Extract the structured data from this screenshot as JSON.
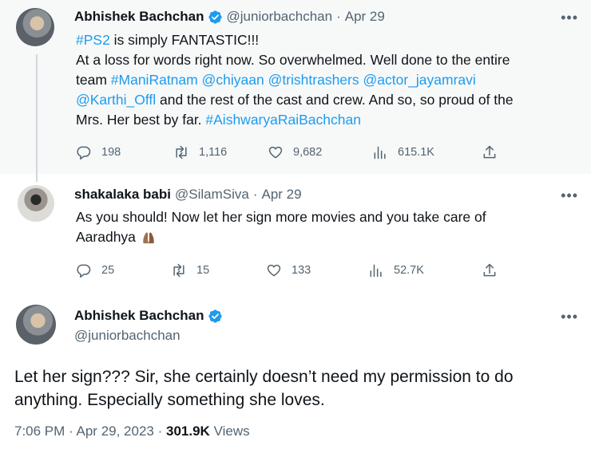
{
  "tweet1": {
    "name": "Abhishek Bachchan",
    "handle": "@juniorbachchan",
    "sep": "·",
    "date": "Apr 29",
    "more": "•••",
    "hashtag_ps2": "#PS2",
    "line1_rest": " is simply FANTASTIC!!!",
    "line2": "At a loss for words right now. So overwhelmed. Well done to the entire",
    "line3_pre": "team ",
    "m1": "#ManiRatnam",
    "m2": "@chiyaan",
    "m3": "@trishtrashers",
    "m4": "@actor_jayamravi",
    "m5": "@Karthi_Offl",
    "line4_rest": " and the rest of the cast and crew. And so, so proud of the",
    "line5_pre": "Mrs. Her best by far. ",
    "m6": "#AishwaryaRaiBachchan",
    "stats": {
      "replies": "198",
      "retweets": "1,116",
      "likes": "9,682",
      "views": "615.1K"
    }
  },
  "tweet2": {
    "name": "shakalaka babi",
    "handle": "@SilamSiva",
    "sep": "·",
    "date": "Apr 29",
    "more": "•••",
    "line1": "As you should! Now let her sign more movies and you take care of",
    "line2": "Aaradhya",
    "stats": {
      "replies": "25",
      "retweets": "15",
      "likes": "133",
      "views": "52.7K"
    }
  },
  "tweet3": {
    "name": "Abhishek Bachchan",
    "handle": "@juniorbachchan",
    "more": "•••",
    "text": "Let her sign??? Sir, she certainly doesn’t need my permission to do anything. Especially something she loves.",
    "time": "7:06 PM",
    "sep1": "·",
    "date": "Apr 29, 2023",
    "sep2": "·",
    "views_count": "301.9K",
    "views_label": "Views"
  },
  "colors": {
    "link": "#1d9bf0",
    "muted": "#536471",
    "verified": "#1d9bf0",
    "highlight_bg": "#f7f9f9"
  },
  "icons": [
    "verified-badge-icon",
    "reply-icon",
    "retweet-icon",
    "like-icon",
    "views-icon",
    "share-icon",
    "more-icon",
    "folded-hands-emoji"
  ]
}
